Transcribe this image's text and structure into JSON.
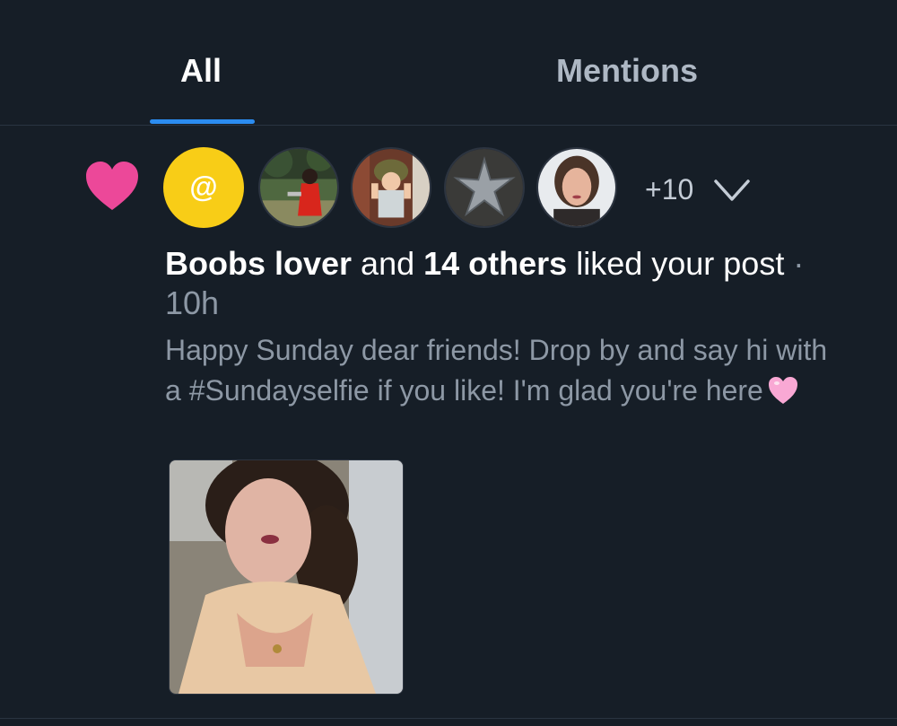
{
  "tabs": {
    "all": "All",
    "mentions": "Mentions",
    "active": "All"
  },
  "notification": {
    "mention_symbol": "@",
    "avatars": [
      "mention-avatar",
      "person-in-red-jacket",
      "child-in-helmet",
      "starfish",
      "woman-portrait"
    ],
    "more_count": "+10",
    "actor": "Boobs lover",
    "connector": " and ",
    "others": "14 others",
    "action": " liked your post",
    "separator": " · ",
    "time": "10h",
    "post_text": "Happy Sunday dear friends! Drop by and say hi with a #Sundayselfie if you like! I'm glad you're here",
    "post_emoji": "pink-heart-icon",
    "image_alt": "selfie-photo"
  },
  "colors": {
    "background": "#161e27",
    "accent": "#2b8cf0",
    "like_heart": "#ec4899",
    "mention_avatar": "#f8cd17",
    "muted_text": "#8d98a5"
  }
}
